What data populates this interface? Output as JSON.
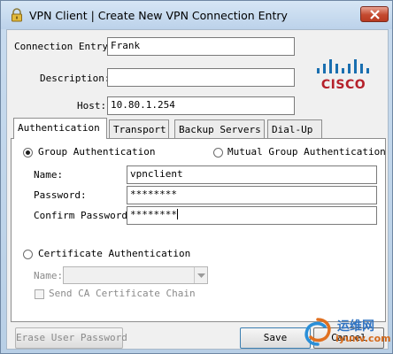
{
  "window": {
    "title": "VPN Client  |  Create New VPN Connection Entry"
  },
  "form": {
    "connection_entry_label": "Connection Entry:",
    "connection_entry_value": "Frank",
    "description_label": "Description:",
    "description_value": "",
    "host_label": "Host:",
    "host_value": "10.80.1.254"
  },
  "logo": {
    "text": "CISCO"
  },
  "tabs": [
    {
      "label": "Authentication",
      "active": true
    },
    {
      "label": "Transport",
      "active": false
    },
    {
      "label": "Backup Servers",
      "active": false
    },
    {
      "label": "Dial-Up",
      "active": false
    }
  ],
  "auth": {
    "group_auth_label": "Group Authentication",
    "group_auth_selected": true,
    "mutual_group_auth_label": "Mutual Group Authentication",
    "mutual_group_auth_selected": false,
    "name_label": "Name:",
    "name_value": "vpnclient",
    "password_label": "Password:",
    "password_value": "********",
    "confirm_password_label": "Confirm Password:",
    "confirm_password_value": "********",
    "cert_auth_label": "Certificate Authentication",
    "cert_auth_selected": false,
    "cert_name_label": "Name:",
    "cert_name_value": "",
    "send_ca_label": "Send CA Certificate Chain",
    "send_ca_checked": false
  },
  "buttons": {
    "erase_password": "Erase User Password",
    "save": "Save",
    "cancel": "Cancel"
  },
  "watermark": {
    "line1": "运维网",
    "line2": "iyunv.com"
  },
  "colors": {
    "cisco_red": "#b5212b",
    "cisco_blue": "#1a6fb0",
    "title_bar": "#c9dcef",
    "close_button": "#c44a2f"
  }
}
